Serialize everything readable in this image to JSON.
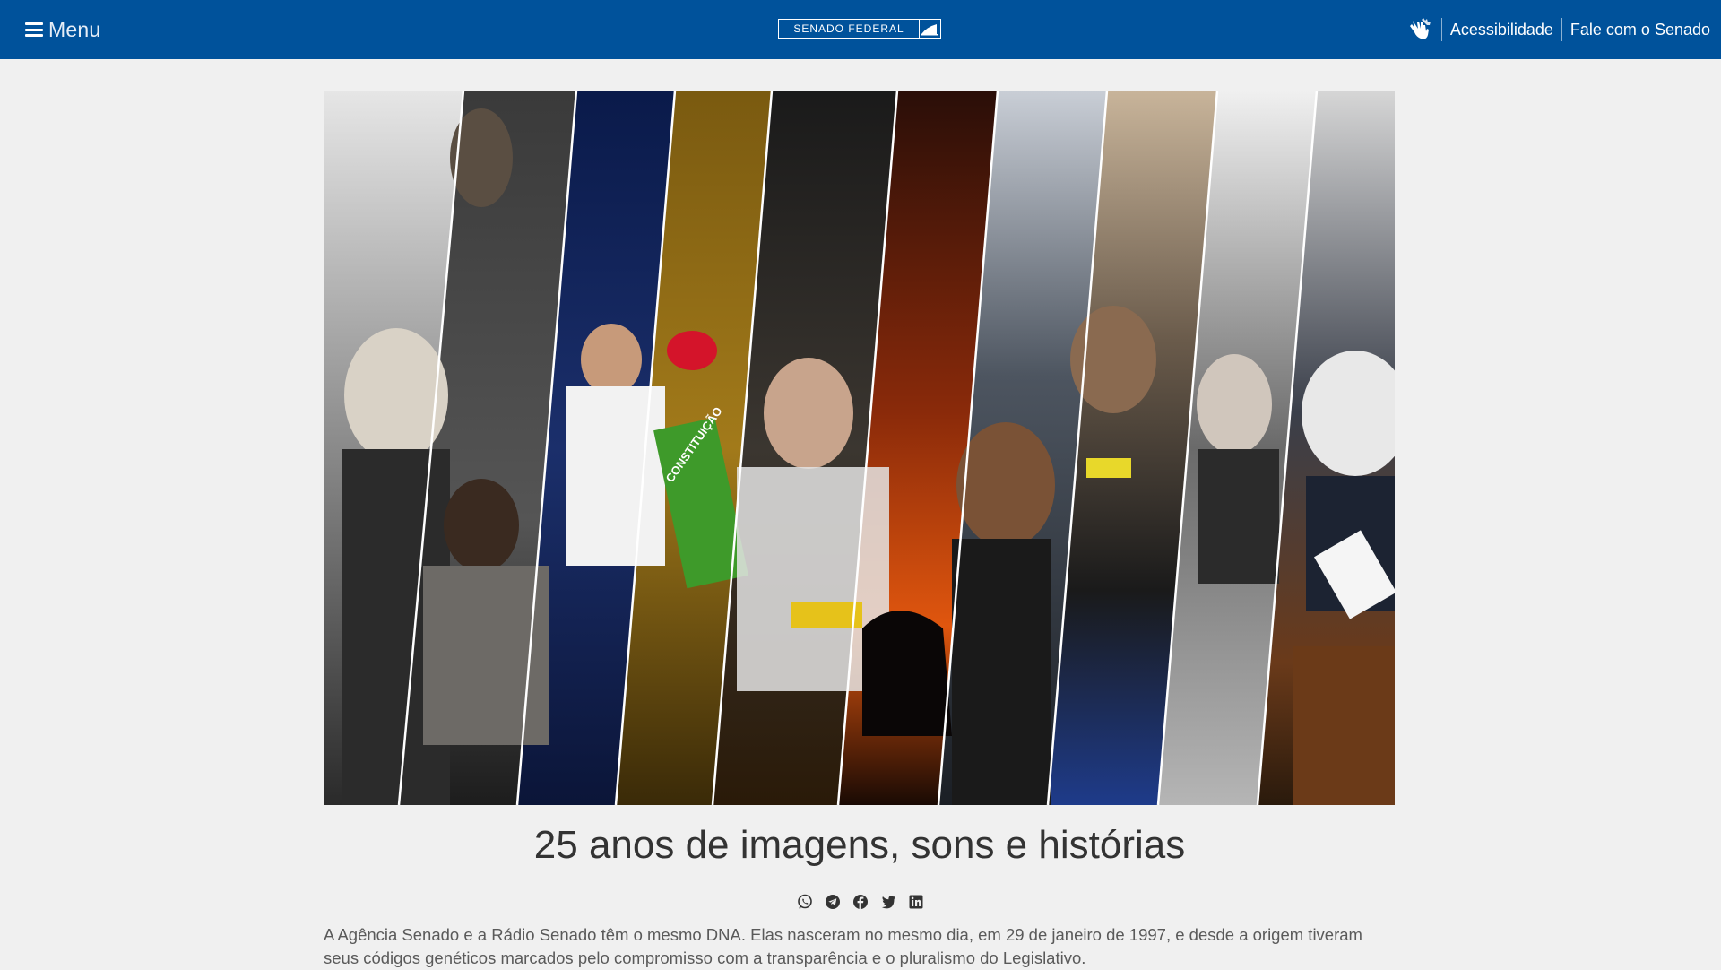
{
  "header": {
    "menu_label": "Menu",
    "logo_text": "SENADO FEDERAL",
    "accessibility_label": "Acessibilidade",
    "contact_label": "Fale com o Senado",
    "colors": {
      "bar": "#00529b",
      "text": "#ffffff"
    }
  },
  "hero": {
    "icon": "photo-collage",
    "badge_text": "CONSTITUIÇÃO"
  },
  "article": {
    "headline": "25 anos de imagens, sons e histórias",
    "share_icons": [
      "whatsapp-icon",
      "telegram-icon",
      "facebook-icon",
      "twitter-icon",
      "linkedin-icon"
    ],
    "lead": "A Agência Senado e a Rádio Senado têm o mesmo DNA. Elas nasceram no mesmo dia, em 29 de janeiro de 1997, e desde a origem tiveram seus códigos genéticos marcados pelo compromisso com a transparência e o pluralismo do Legislativo."
  }
}
